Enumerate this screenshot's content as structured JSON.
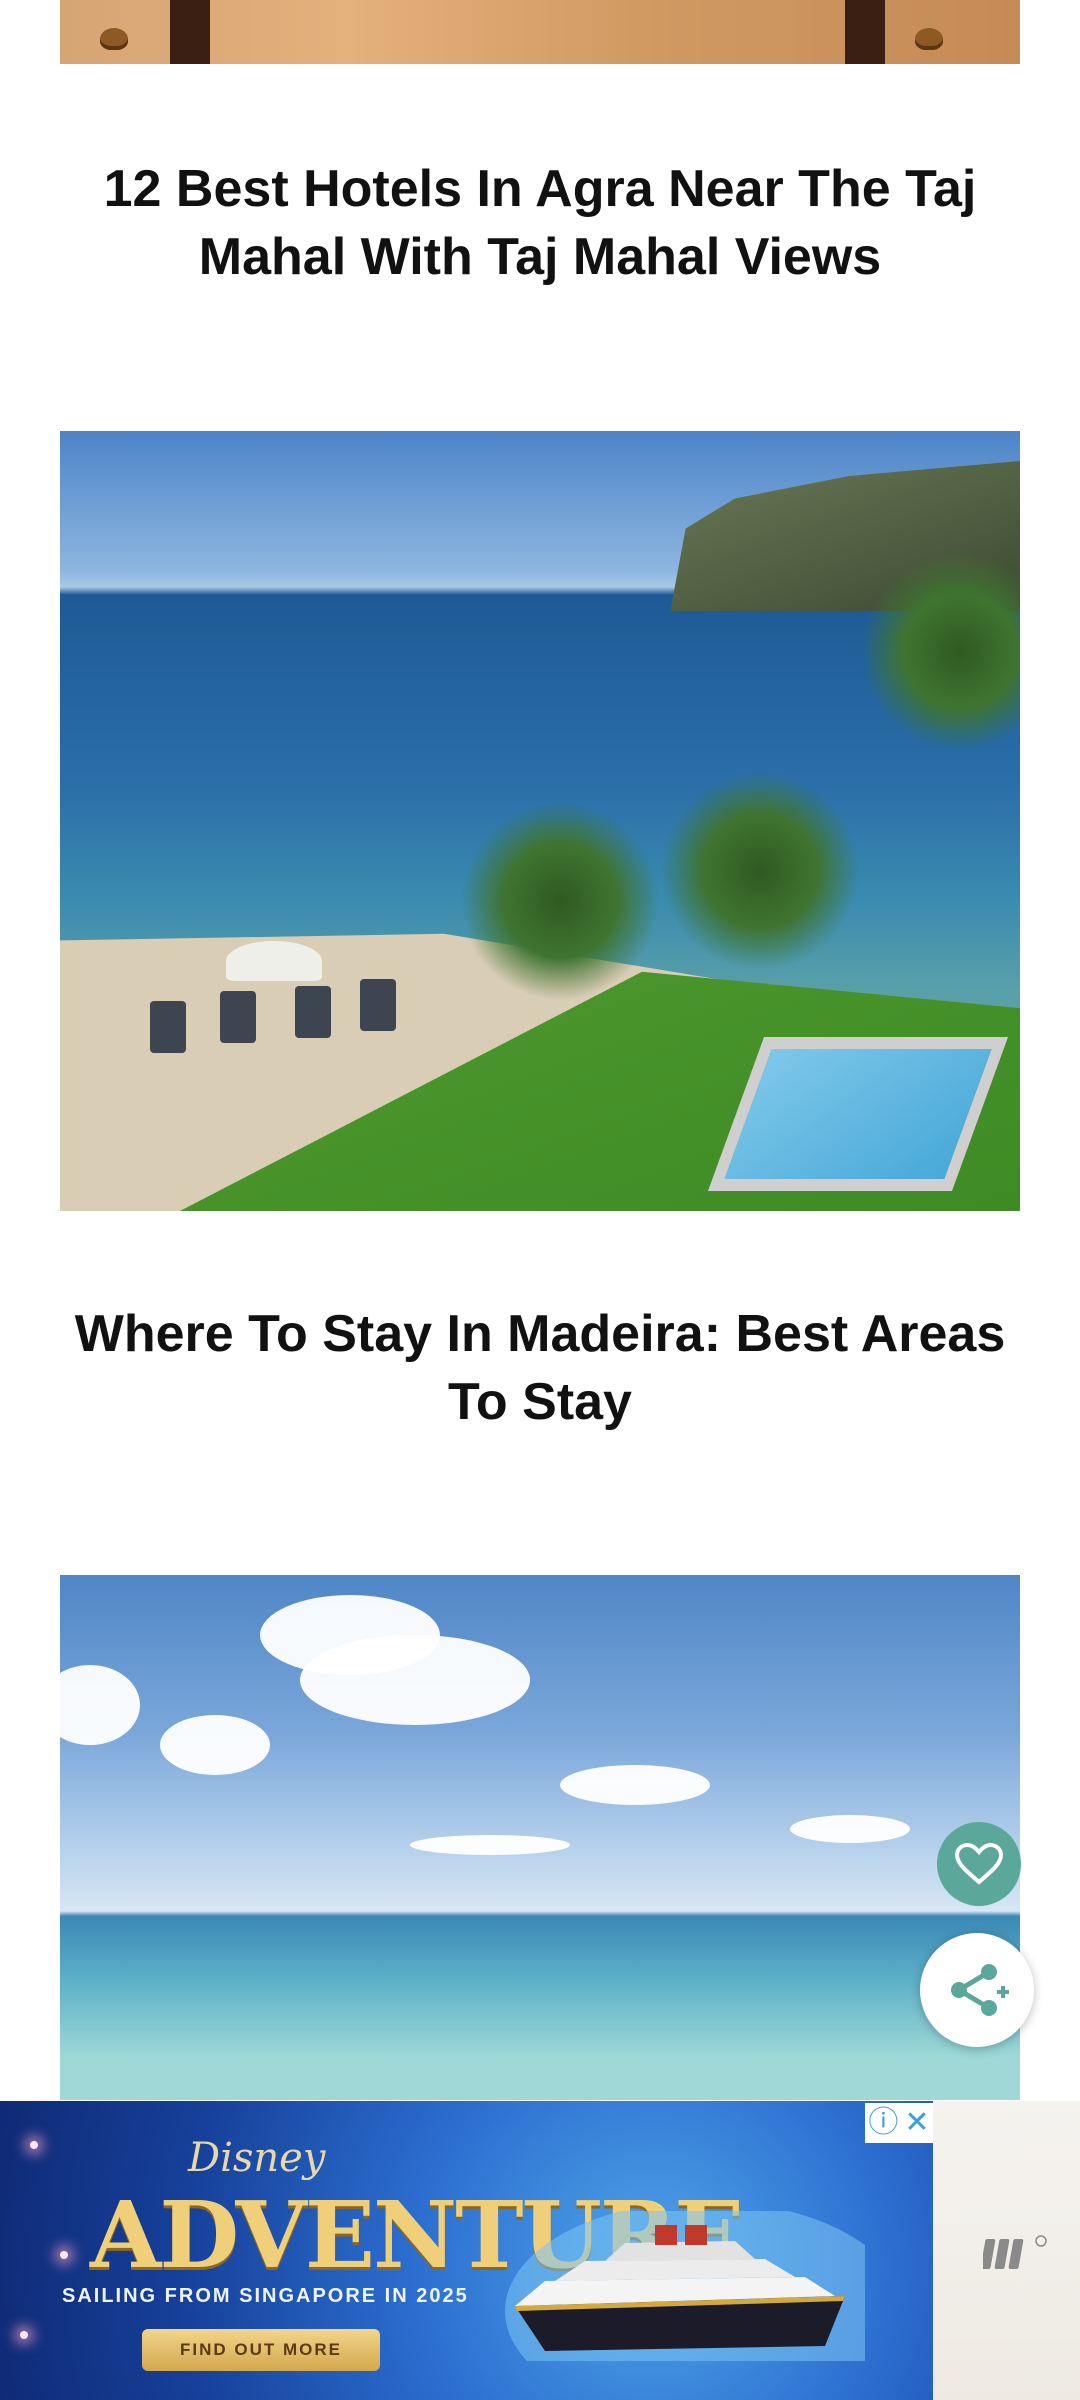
{
  "articles": [
    {
      "title": "12 Best Hotels In Agra Near The Taj Mahal With Taj Mahal Views"
    },
    {
      "title": "Where To Stay In Madeira: Best Areas To Stay"
    }
  ],
  "ad": {
    "brand": "Disney",
    "headline": "ADVENTURE",
    "tagline": "SAILING FROM SINGAPORE IN 2025",
    "cta": "FIND OUT MORE",
    "close_icon": "close-icon",
    "info_icon": "info-icon"
  },
  "floating_actions": {
    "favorite_icon": "heart-icon",
    "share_icon": "share-icon",
    "accent_color": "#5ba89b"
  }
}
